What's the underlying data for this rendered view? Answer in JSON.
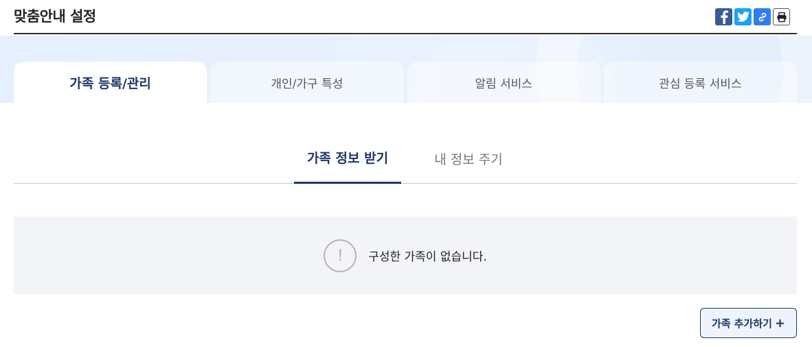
{
  "header": {
    "title": "맞춤안내 설정",
    "share": {
      "facebook_icon": "facebook-icon",
      "twitter_icon": "twitter-icon",
      "link_icon": "link-icon",
      "print_icon": "print-icon"
    }
  },
  "main_tabs": [
    {
      "label": "가족 등록/관리",
      "active": true
    },
    {
      "label": "개인/가구 특성",
      "active": false
    },
    {
      "label": "알림 서비스",
      "active": false
    },
    {
      "label": "관심 등록 서비스",
      "active": false
    }
  ],
  "sub_tabs": [
    {
      "label": "가족 정보 받기",
      "active": true
    },
    {
      "label": "내 정보 주기",
      "active": false
    }
  ],
  "empty_state": {
    "icon": "exclamation-circle-icon",
    "icon_glyph": "!",
    "message": "구성한 가족이 없습니다."
  },
  "add_button": {
    "label": "가족 추가하기",
    "icon_glyph": "+"
  },
  "colors": {
    "accent": "#1e3766",
    "banner": "#e6effd"
  }
}
